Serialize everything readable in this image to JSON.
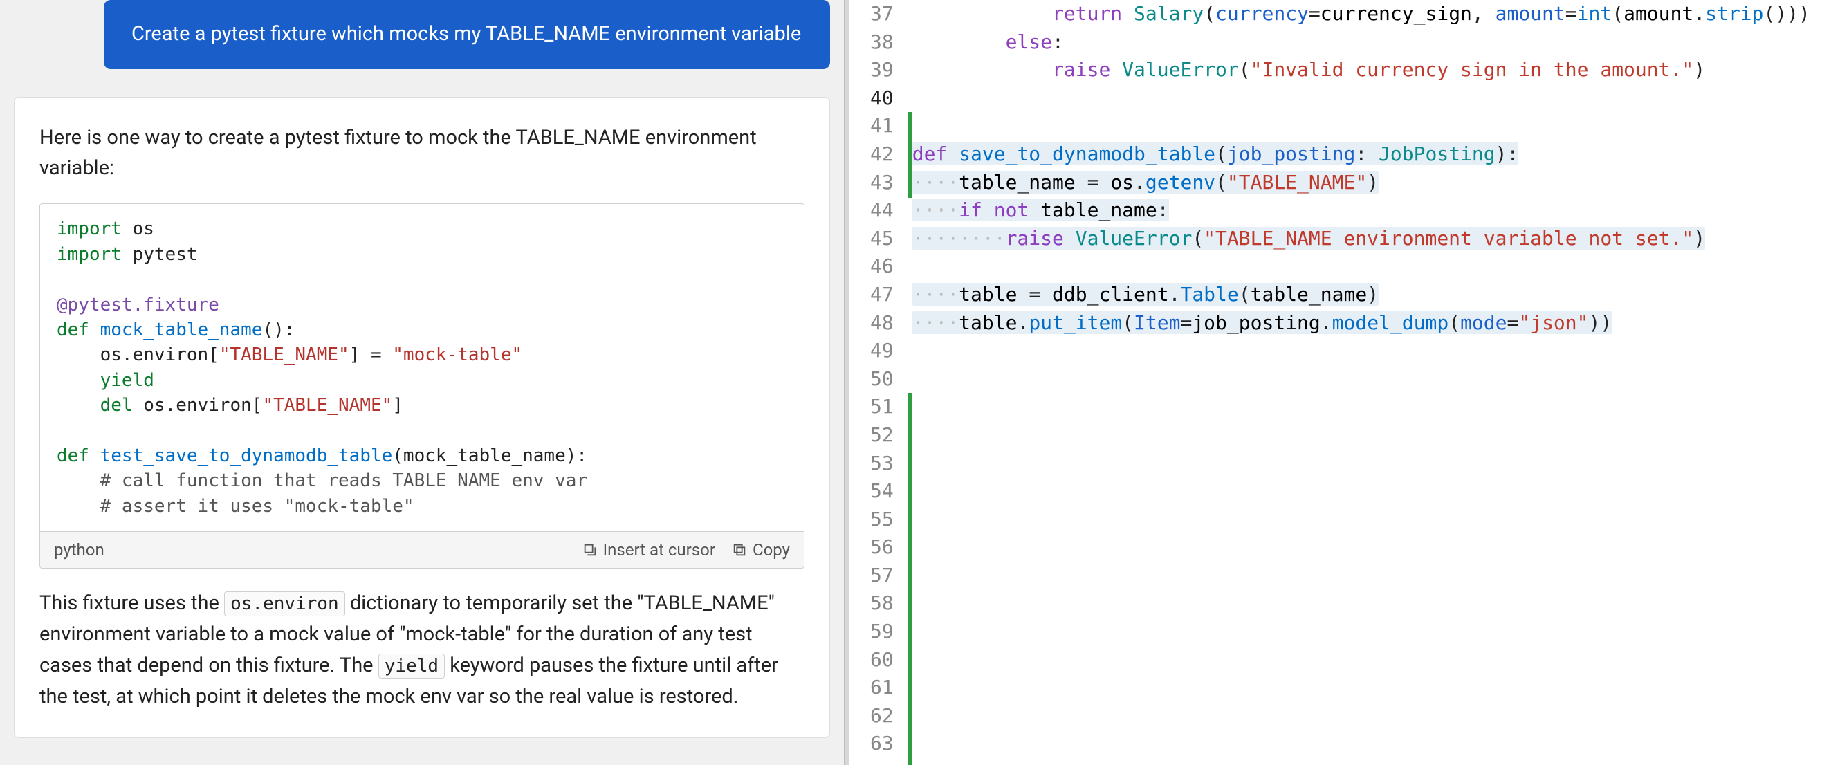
{
  "chat": {
    "user_message": "Create a pytest fixture which mocks my TABLE_NAME environment variable"
  },
  "response": {
    "intro": "Here is one way to create a pytest fixture to mock the TABLE_NAME environment variable:",
    "code_lines": [
      [
        {
          "c": "kw",
          "t": "import"
        },
        {
          "c": "",
          "t": " os"
        }
      ],
      [
        {
          "c": "kw",
          "t": "import"
        },
        {
          "c": "",
          "t": " pytest"
        }
      ],
      [],
      [
        {
          "c": "dec",
          "t": "@pytest.fixture"
        }
      ],
      [
        {
          "c": "kw",
          "t": "def"
        },
        {
          "c": "",
          "t": " "
        },
        {
          "c": "fn",
          "t": "mock_table_name"
        },
        {
          "c": "",
          "t": "():"
        }
      ],
      [
        {
          "c": "",
          "t": "    os.environ["
        },
        {
          "c": "str",
          "t": "\"TABLE_NAME\""
        },
        {
          "c": "",
          "t": "] = "
        },
        {
          "c": "str",
          "t": "\"mock-table\""
        }
      ],
      [
        {
          "c": "",
          "t": "    "
        },
        {
          "c": "kw",
          "t": "yield"
        }
      ],
      [
        {
          "c": "",
          "t": "    "
        },
        {
          "c": "kw",
          "t": "del"
        },
        {
          "c": "",
          "t": " os.environ["
        },
        {
          "c": "str",
          "t": "\"TABLE_NAME\""
        },
        {
          "c": "",
          "t": "]"
        }
      ],
      [],
      [
        {
          "c": "kw",
          "t": "def"
        },
        {
          "c": "",
          "t": " "
        },
        {
          "c": "fn",
          "t": "test_save_to_dynamodb_table"
        },
        {
          "c": "",
          "t": "(mock_table_name):"
        }
      ],
      [
        {
          "c": "",
          "t": "    "
        },
        {
          "c": "cmt",
          "t": "# call function that reads TABLE_NAME env var"
        }
      ],
      [
        {
          "c": "",
          "t": "    "
        },
        {
          "c": "cmt",
          "t": "# assert it uses \"mock-table\""
        }
      ]
    ],
    "code_lang": "python",
    "actions": {
      "insert": "Insert at cursor",
      "copy": "Copy"
    },
    "outro_parts": [
      {
        "type": "text",
        "t": "This fixture uses the "
      },
      {
        "type": "code",
        "t": "os.environ"
      },
      {
        "type": "text",
        "t": " dictionary to temporarily set the \"TABLE_NAME\" environment variable to a mock value of \"mock-table\" for the duration of any test cases that depend on this fixture. The "
      },
      {
        "type": "code",
        "t": "yield"
      },
      {
        "type": "text",
        "t": " keyword pauses the fixture until after the test, at which point it deletes the mock env var so the real value is restored."
      }
    ]
  },
  "editor": {
    "current_line": 40,
    "lines": [
      {
        "n": 37,
        "sel": false,
        "spans": [
          {
            "c": "",
            "t": "            "
          },
          {
            "c": "ekw",
            "t": "return"
          },
          {
            "c": "",
            "t": " "
          },
          {
            "c": "ecls",
            "t": "Salary"
          },
          {
            "c": "eop",
            "t": "("
          },
          {
            "c": "evar",
            "t": "currency"
          },
          {
            "c": "eop",
            "t": "="
          },
          {
            "c": "",
            "t": "currency_sign"
          },
          {
            "c": "eop",
            "t": ", "
          },
          {
            "c": "evar",
            "t": "amount"
          },
          {
            "c": "eop",
            "t": "="
          },
          {
            "c": "efn",
            "t": "int"
          },
          {
            "c": "eop",
            "t": "("
          },
          {
            "c": "",
            "t": "amount"
          },
          {
            "c": "eop",
            "t": "."
          },
          {
            "c": "efn",
            "t": "strip"
          },
          {
            "c": "eop",
            "t": "()))"
          }
        ]
      },
      {
        "n": 38,
        "sel": false,
        "spans": [
          {
            "c": "",
            "t": "        "
          },
          {
            "c": "ekw",
            "t": "else"
          },
          {
            "c": "eop",
            "t": ":"
          }
        ]
      },
      {
        "n": 39,
        "sel": false,
        "spans": [
          {
            "c": "",
            "t": "            "
          },
          {
            "c": "ekw",
            "t": "raise"
          },
          {
            "c": "",
            "t": " "
          },
          {
            "c": "ecls",
            "t": "ValueError"
          },
          {
            "c": "eop",
            "t": "("
          },
          {
            "c": "estr",
            "t": "\"Invalid currency sign in the amount.\""
          },
          {
            "c": "eop",
            "t": ")"
          }
        ]
      },
      {
        "n": 40,
        "sel": true,
        "spans": [
          {
            "c": "",
            "t": ""
          }
        ]
      },
      {
        "n": 41,
        "sel": false,
        "spans": []
      },
      {
        "n": 42,
        "sel": true,
        "spans": [
          {
            "c": "ekw",
            "t": "def"
          },
          {
            "c": "",
            "t": " "
          },
          {
            "c": "efn",
            "t": "save_to_dynamodb_table"
          },
          {
            "c": "eop",
            "t": "("
          },
          {
            "c": "evar",
            "t": "job_posting"
          },
          {
            "c": "eop",
            "t": ": "
          },
          {
            "c": "ecls",
            "t": "JobPosting"
          },
          {
            "c": "eop",
            "t": "):"
          }
        ]
      },
      {
        "n": 43,
        "sel": true,
        "spans": [
          {
            "c": "indent-dots",
            "t": "····"
          },
          {
            "c": "",
            "t": "table_name "
          },
          {
            "c": "eop",
            "t": "= "
          },
          {
            "c": "",
            "t": "os"
          },
          {
            "c": "eop",
            "t": "."
          },
          {
            "c": "efn",
            "t": "getenv"
          },
          {
            "c": "eop",
            "t": "("
          },
          {
            "c": "estr",
            "t": "\"TABLE_NAME\""
          },
          {
            "c": "eop",
            "t": ")"
          }
        ]
      },
      {
        "n": 44,
        "sel": true,
        "spans": [
          {
            "c": "indent-dots",
            "t": "····"
          },
          {
            "c": "ekw",
            "t": "if"
          },
          {
            "c": "",
            "t": " "
          },
          {
            "c": "ekw",
            "t": "not"
          },
          {
            "c": "",
            "t": " table_name"
          },
          {
            "c": "eop",
            "t": ":"
          }
        ]
      },
      {
        "n": 45,
        "sel": true,
        "spans": [
          {
            "c": "indent-dots",
            "t": "········"
          },
          {
            "c": "ekw",
            "t": "raise"
          },
          {
            "c": "",
            "t": " "
          },
          {
            "c": "ecls",
            "t": "ValueError"
          },
          {
            "c": "eop",
            "t": "("
          },
          {
            "c": "estr",
            "t": "\"TABLE_NAME environment variable not set.\""
          },
          {
            "c": "eop",
            "t": ")"
          }
        ]
      },
      {
        "n": 46,
        "sel": true,
        "spans": [
          {
            "c": "",
            "t": ""
          }
        ]
      },
      {
        "n": 47,
        "sel": true,
        "spans": [
          {
            "c": "indent-dots",
            "t": "····"
          },
          {
            "c": "",
            "t": "table "
          },
          {
            "c": "eop",
            "t": "= "
          },
          {
            "c": "",
            "t": "ddb_client"
          },
          {
            "c": "eop",
            "t": "."
          },
          {
            "c": "efn",
            "t": "Table"
          },
          {
            "c": "eop",
            "t": "("
          },
          {
            "c": "",
            "t": "table_name"
          },
          {
            "c": "eop",
            "t": ")"
          }
        ]
      },
      {
        "n": 48,
        "sel": true,
        "spans": [
          {
            "c": "indent-dots",
            "t": "····"
          },
          {
            "c": "",
            "t": "table"
          },
          {
            "c": "eop",
            "t": "."
          },
          {
            "c": "efn",
            "t": "put_item"
          },
          {
            "c": "eop",
            "t": "("
          },
          {
            "c": "evar",
            "t": "Item"
          },
          {
            "c": "eop",
            "t": "="
          },
          {
            "c": "",
            "t": "job_posting"
          },
          {
            "c": "eop",
            "t": "."
          },
          {
            "c": "efn",
            "t": "model_dump"
          },
          {
            "c": "eop",
            "t": "("
          },
          {
            "c": "evar",
            "t": "mode"
          },
          {
            "c": "eop",
            "t": "="
          },
          {
            "c": "estr",
            "t": "\"json\""
          },
          {
            "c": "eop",
            "t": "))"
          }
        ]
      },
      {
        "n": 49,
        "sel": false,
        "spans": []
      },
      {
        "n": 50,
        "sel": false,
        "spans": []
      },
      {
        "n": 51,
        "sel": false,
        "spans": []
      },
      {
        "n": 52,
        "sel": false,
        "spans": []
      },
      {
        "n": 53,
        "sel": false,
        "spans": []
      },
      {
        "n": 54,
        "sel": false,
        "spans": []
      },
      {
        "n": 55,
        "sel": false,
        "spans": []
      },
      {
        "n": 56,
        "sel": false,
        "spans": []
      },
      {
        "n": 57,
        "sel": false,
        "spans": []
      },
      {
        "n": 58,
        "sel": false,
        "spans": []
      },
      {
        "n": 59,
        "sel": false,
        "spans": []
      },
      {
        "n": 60,
        "sel": false,
        "spans": []
      },
      {
        "n": 61,
        "sel": false,
        "spans": []
      },
      {
        "n": 62,
        "sel": false,
        "spans": []
      },
      {
        "n": 63,
        "sel": false,
        "spans": []
      }
    ]
  }
}
